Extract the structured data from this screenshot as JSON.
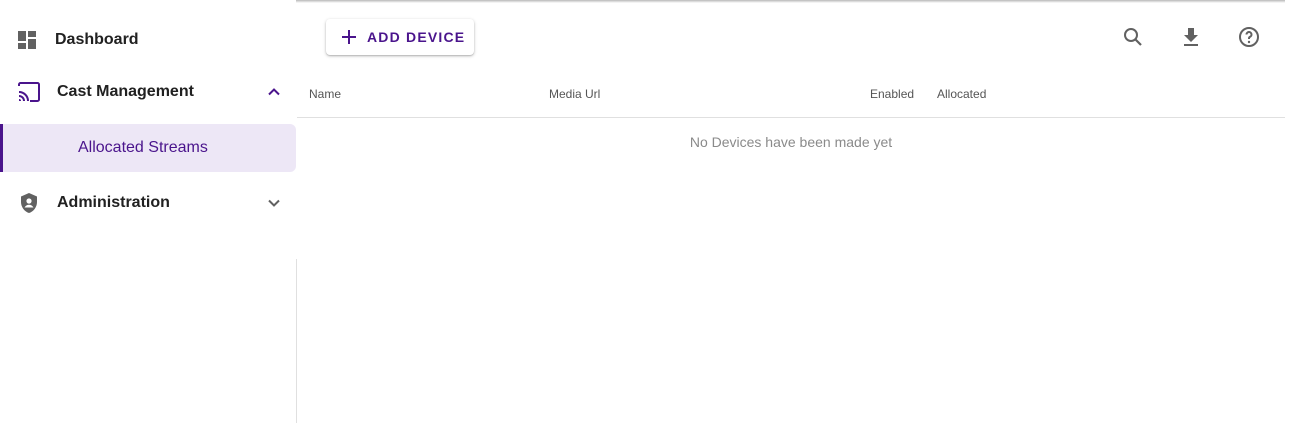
{
  "sidebar": {
    "items": [
      {
        "label": "Dashboard",
        "icon": "dashboard-icon"
      },
      {
        "label": "Cast Management",
        "icon": "cast-icon",
        "expanded": true,
        "children": [
          {
            "label": "Allocated Streams",
            "selected": true
          }
        ]
      },
      {
        "label": "Administration",
        "icon": "admin-shield-icon",
        "expanded": false
      }
    ]
  },
  "toolbar": {
    "add_label": "ADD DEVICE",
    "icons": [
      "search-icon",
      "download-icon",
      "help-icon"
    ]
  },
  "table": {
    "columns": [
      "Name",
      "Media Url",
      "Enabled",
      "Allocated"
    ],
    "empty_message": "No Devices have been made yet"
  },
  "colors": {
    "accent": "#4a148c",
    "selected_bg": "#ede7f6",
    "icon": "#616161"
  }
}
